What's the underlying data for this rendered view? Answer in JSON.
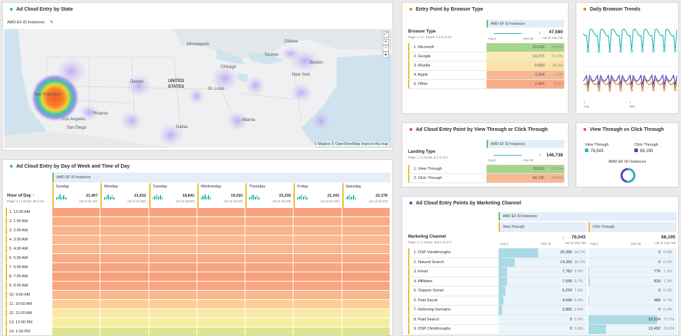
{
  "map_panel": {
    "title": "Ad Cloud Entry by State",
    "metric_label": "AMO EF ID Instances",
    "attribution": "© Mapbox © OpenStreetMap  Improve this map",
    "places": [
      "Minneapolis",
      "Ottawa",
      "Toronto",
      "Boston",
      "Chicago",
      "New York",
      "Denver",
      "UNITED STATES",
      "St. Louis",
      "San Francisco",
      "Los Angeles",
      "San Diego",
      "Phoenix",
      "Dallas",
      "Atlanta"
    ]
  },
  "browser_panel": {
    "title": "Entry Point by Browser Type",
    "metric_label": "AMO EF ID Instances",
    "dimension": "Browser Type",
    "paging": "Page: 1 / 4 ›  Rows: 5  1-5 of 18",
    "total": "47,590",
    "total_sub": "out of 146,738",
    "axis_start": "Aug 1",
    "axis_end": "Sep 30",
    "rows": [
      {
        "label": "1. Microsoft",
        "value": "20,926",
        "pct": "44.0%",
        "color": "#a8d48c",
        "frac": 0.44
      },
      {
        "label": "2. Google",
        "value": "10,273",
        "pct": "21.5%",
        "color": "#fbeab0",
        "frac": 0.215
      },
      {
        "label": "3. Mozilla",
        "value": "8,650",
        "pct": "18.2%",
        "color": "#fbe1a6",
        "frac": 0.182
      },
      {
        "label": "4. Apple",
        "value": "3,368",
        "pct": "7.1%",
        "color": "#f9b892",
        "frac": 0.071
      },
      {
        "label": "5. Other",
        "value": "2,466",
        "pct": "5.2%",
        "color": "#f9ab8a",
        "frac": 0.052
      }
    ]
  },
  "trends_panel": {
    "title": "Daily Browser Trends",
    "x_labels": [
      "1\nAug",
      "1\nSep"
    ],
    "series_colors": [
      "#2fb7bf",
      "#e6841f",
      "#4b47b8"
    ]
  },
  "viewthrough_panel": {
    "title": "Ad Cloud Entry Point by View Through or Click Through",
    "metric_label": "AMO EF ID Instances",
    "dimension": "Landing Type",
    "paging": "Page: 1 / 1  Rows: 5  1-2 of 2",
    "total": "146,738",
    "axis_start": "Aug 1",
    "axis_end": "Sep 30",
    "rows": [
      {
        "label": "1. View Through",
        "value": "78,543",
        "pct": "53.5%",
        "color": "#a8d48c"
      },
      {
        "label": "2. Click Through",
        "value": "68,195",
        "pct": "46.5%",
        "color": "#f9b892"
      }
    ]
  },
  "donut_panel": {
    "title": "View Through vs Click Through",
    "legend": [
      {
        "label": "View Through",
        "value": "78,543",
        "color": "#2fb7bf"
      },
      {
        "label": "Click Through",
        "value": "68,195",
        "color": "#4b47b8"
      }
    ],
    "metric_label": "AMO EF ID Instances",
    "shares": [
      0.535,
      0.465
    ]
  },
  "dow_panel": {
    "title": "Ad Cloud Entry by Day of Week and Time of Day",
    "metric_label": "AMO EF ID Instances",
    "dimension": "Hour of Day",
    "paging": "Page: 1 / 1  Rows: 50  1-24",
    "days": [
      {
        "name": "Sunday",
        "value": "21,407",
        "sub": "out of 21,407"
      },
      {
        "name": "Monday",
        "value": "21,622",
        "sub": "out of 21,622"
      },
      {
        "name": "Tuesday",
        "value": "18,843",
        "sub": "out of 18,843"
      },
      {
        "name": "Wednesday",
        "value": "19,010",
        "sub": "out of 19,010"
      },
      {
        "name": "Thursday",
        "value": "22,235",
        "sub": "out of 22,235"
      },
      {
        "name": "Friday",
        "value": "21,343",
        "sub": "out of 21,343"
      },
      {
        "name": "Saturday",
        "value": "22,378",
        "sub": "out of 22,378"
      }
    ],
    "hours": [
      "1. 12:00 AM",
      "2. 1:00 AM",
      "3. 2:00 AM",
      "4. 3:00 AM",
      "5. 4:00 AM",
      "6. 5:00 AM",
      "7. 6:00 AM",
      "8. 7:00 AM",
      "9. 8:00 AM",
      "10. 9:00 AM",
      "11. 10:00 AM",
      "12. 11:00 AM",
      "13. 12:00 PM",
      "14. 1:00 PM"
    ],
    "row_colors": [
      "#f8a380",
      "#f9ad87",
      "#f9b38b",
      "#fab98f",
      "#fab790",
      "#f9ad86",
      "#f9a480",
      "#f8a07c",
      "#f9a680",
      "#fab88e",
      "#fbcf96",
      "#fbe9a4",
      "#f6ee9f",
      "#dfe48e"
    ]
  },
  "channel_panel": {
    "title": "Ad Cloud Entry Points by Marketing Channel",
    "metric_label": "AMO EF ID Instances",
    "col1": "View Through",
    "col2": "Click Through",
    "dimension": "Marketing Channel",
    "paging": "Page: 1 / 1  Rows: 400  1-9 of 9",
    "total1": "78,543",
    "total1_sub": "out of 146,738",
    "total2": "68,195",
    "total2_sub": "out of 146,738",
    "axis_start": "Aug 1",
    "axis_end": "Sep 30",
    "rows": [
      {
        "label": "1. DSP Viewthroughs",
        "v1": "35,095",
        "p1": "44.7%",
        "f1": 0.447,
        "v2": "0",
        "p2": "0.0%",
        "f2": 0
      },
      {
        "label": "2. Natural Search",
        "v1": "14,350",
        "p1": "18.3%",
        "f1": 0.183,
        "v2": "0",
        "p2": "0.0%",
        "f2": 0
      },
      {
        "label": "3. Email",
        "v1": "7,762",
        "p1": "9.9%",
        "f1": 0.099,
        "v2": "776",
        "p2": "1.1%",
        "f2": 0.011
      },
      {
        "label": "4. Affiliates",
        "v1": "7,656",
        "p1": "9.7%",
        "f1": 0.097,
        "v2": "818",
        "p2": "1.2%",
        "f2": 0.012
      },
      {
        "label": "5. Organic Social",
        "v1": "6,229",
        "p1": "7.9%",
        "f1": 0.079,
        "v2": "0",
        "p2": "0.0%",
        "f2": 0
      },
      {
        "label": "6. Paid Social",
        "v1": "4,596",
        "p1": "5.9%",
        "f1": 0.059,
        "v2": "485",
        "p2": "0.7%",
        "f2": 0.007
      },
      {
        "label": "7. Referring Domains",
        "v1": "2,855",
        "p1": "3.6%",
        "f1": 0.036,
        "v2": "0",
        "p2": "0.0%",
        "f2": 0
      },
      {
        "label": "8. Paid Search",
        "v1": "0",
        "p1": "0.0%",
        "f1": 0,
        "v2": "52,624",
        "p2": "77.2%",
        "f2": 0.772
      },
      {
        "label": "9. DSP Clickthroughs",
        "v1": "0",
        "p1": "0.0%",
        "f1": 0,
        "v2": "13,492",
        "p2": "19.8%",
        "f2": 0.198
      }
    ]
  }
}
